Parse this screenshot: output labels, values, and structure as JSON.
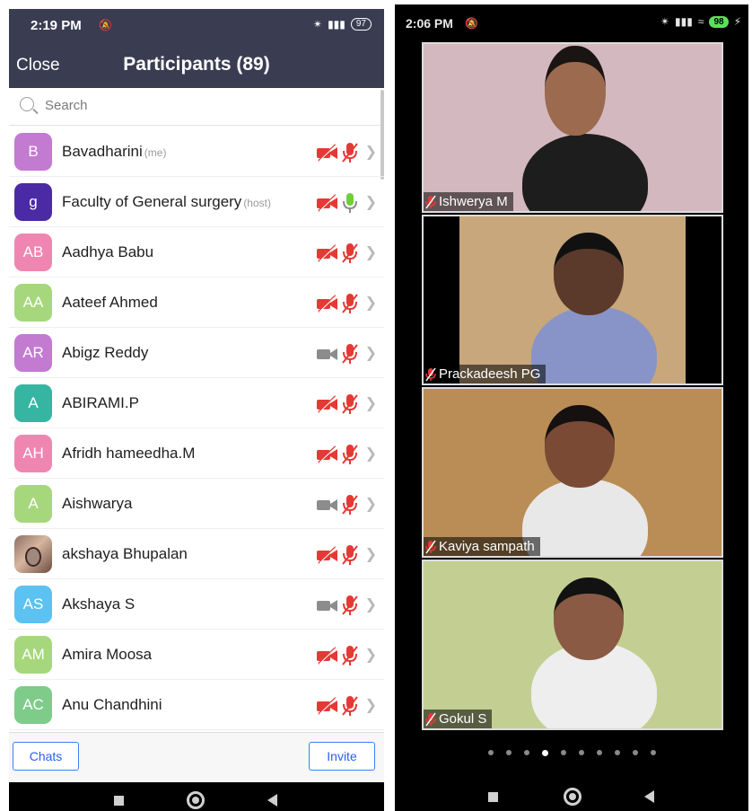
{
  "left": {
    "status": {
      "time": "2:19 PM",
      "battery": "97"
    },
    "header": {
      "close": "Close",
      "title": "Participants (89)"
    },
    "search": {
      "placeholder": "Search"
    },
    "participants": [
      {
        "initials": "B",
        "name": "Bavadharini",
        "tag": "(me)",
        "color": "#c37ad1",
        "video": "off",
        "mic": "muted"
      },
      {
        "initials": "g",
        "name": "Faculty of General surgery",
        "tag": "(host)",
        "color": "#4b2aa6",
        "video": "off",
        "mic": "on"
      },
      {
        "initials": "AB",
        "name": "Aadhya Babu",
        "tag": "",
        "color": "#ef86b1",
        "video": "off",
        "mic": "muted"
      },
      {
        "initials": "AA",
        "name": "Aateef Ahmed",
        "tag": "",
        "color": "#a6d77c",
        "video": "off",
        "mic": "muted"
      },
      {
        "initials": "AR",
        "name": "Abigz Reddy",
        "tag": "",
        "color": "#c37ad1",
        "video": "on",
        "mic": "muted"
      },
      {
        "initials": "A",
        "name": "ABIRAMI.P",
        "tag": "",
        "color": "#36b5a2",
        "video": "off",
        "mic": "muted"
      },
      {
        "initials": "AH",
        "name": "Afridh hameedha.M",
        "tag": "",
        "color": "#ef86b1",
        "video": "off",
        "mic": "muted"
      },
      {
        "initials": "A",
        "name": "Aishwarya",
        "tag": "",
        "color": "#a6d77c",
        "video": "on",
        "mic": "muted"
      },
      {
        "initials": "",
        "name": "akshaya Bhupalan",
        "tag": "",
        "color": "#8d6e63",
        "video": "off",
        "mic": "muted",
        "photo": true
      },
      {
        "initials": "AS",
        "name": "Akshaya S",
        "tag": "",
        "color": "#5bc2f2",
        "video": "on",
        "mic": "muted"
      },
      {
        "initials": "AM",
        "name": "Amira Moosa",
        "tag": "",
        "color": "#a6d77c",
        "video": "off",
        "mic": "muted"
      },
      {
        "initials": "AC",
        "name": "Anu Chandhini",
        "tag": "",
        "color": "#7ecb8a",
        "video": "off",
        "mic": "muted"
      }
    ],
    "footer": {
      "chats": "Chats",
      "invite": "Invite"
    }
  },
  "right": {
    "status": {
      "time": "2:06 PM",
      "battery": "98"
    },
    "tiles": [
      {
        "name": "Ishwerya M",
        "bg": "#d4b8bf",
        "shirt": "#1d1d1d",
        "skin": "#9b6a4f",
        "hair": "#1a1412"
      },
      {
        "name": "Prackadeesh PG",
        "bg": "#c7a77b",
        "shirt": "#8894c7",
        "skin": "#5b3a2b",
        "hair": "#111111"
      },
      {
        "name": "Kaviya sampath",
        "bg": "#b98d55",
        "shirt": "#e8e8e8",
        "skin": "#7a4a35",
        "hair": "#161010"
      },
      {
        "name": "Gokul S",
        "bg": "#c3cf92",
        "shirt": "#eeeeee",
        "skin": "#8a5a44",
        "hair": "#121212"
      }
    ],
    "pages": {
      "count": 10,
      "active": 3
    }
  },
  "colors": {
    "header": "#3a3d52",
    "muted_red": "#e53935",
    "mic_green": "#6fcf3a",
    "accent_blue": "#2563eb"
  }
}
